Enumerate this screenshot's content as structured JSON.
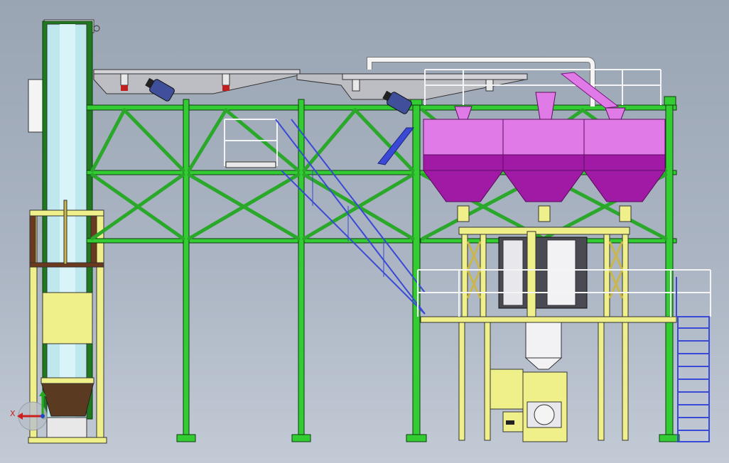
{
  "viewport": {
    "type": "cad-3d-view",
    "background": [
      "#9aa5b4",
      "#c2cad5"
    ]
  },
  "colors": {
    "frame_green": "#33cc33",
    "frame_green_dark": "#1f7a1f",
    "hopper_magenta": "#e07ae6",
    "hopper_dark": "#a11aa6",
    "support_yellow": "#f0f08a",
    "conveyor_cyan": "#bfe8ee",
    "stair_blue": "#3a49d6",
    "railing_white": "#f4f4f4",
    "screen_grey": "#bdbdc4",
    "motor_blue": "#3f4f9a",
    "bucket_brown": "#6b3a1e",
    "axis_x": "#cc1f1f",
    "axis_y": "#22aa22",
    "axis_z": "#2244cc"
  },
  "components": {
    "bucket_elevator": "bucket-elevator",
    "vibrating_screens": "vibrating-screen",
    "storage_hoppers": "storage-hopper",
    "bagging_machine": "bagging-machine",
    "access_stair": "access-stair",
    "hopper_count": 3
  },
  "axis_triad": {
    "x_label": "X"
  }
}
